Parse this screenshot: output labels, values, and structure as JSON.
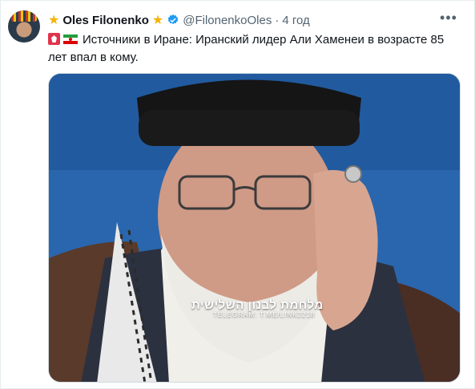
{
  "post": {
    "author_name": "Oles Filonenko",
    "handle": "@FilonenkoOles",
    "separator": "·",
    "time": "4 год",
    "text": "Источники в Иране: Иранский лидер Али Хаменеи в возрасте 85 лет впал в кому.",
    "more_label": "•••",
    "star_left": "★",
    "star_right": "★",
    "media_watermark_title": "מלחמת לבנון השלישית",
    "media_watermark_channel": "TELEGRAM: T.ME/LINK2218"
  },
  "icons": {
    "author_avatar": "avatar-icon",
    "verified": "verified-badge-icon",
    "flags": [
      "red-flag-icon",
      "iran-flag-icon"
    ]
  },
  "colors": {
    "text": "#0f1419",
    "muted": "#536471",
    "verified": "#1d9bf0",
    "star": "#f5b400"
  }
}
